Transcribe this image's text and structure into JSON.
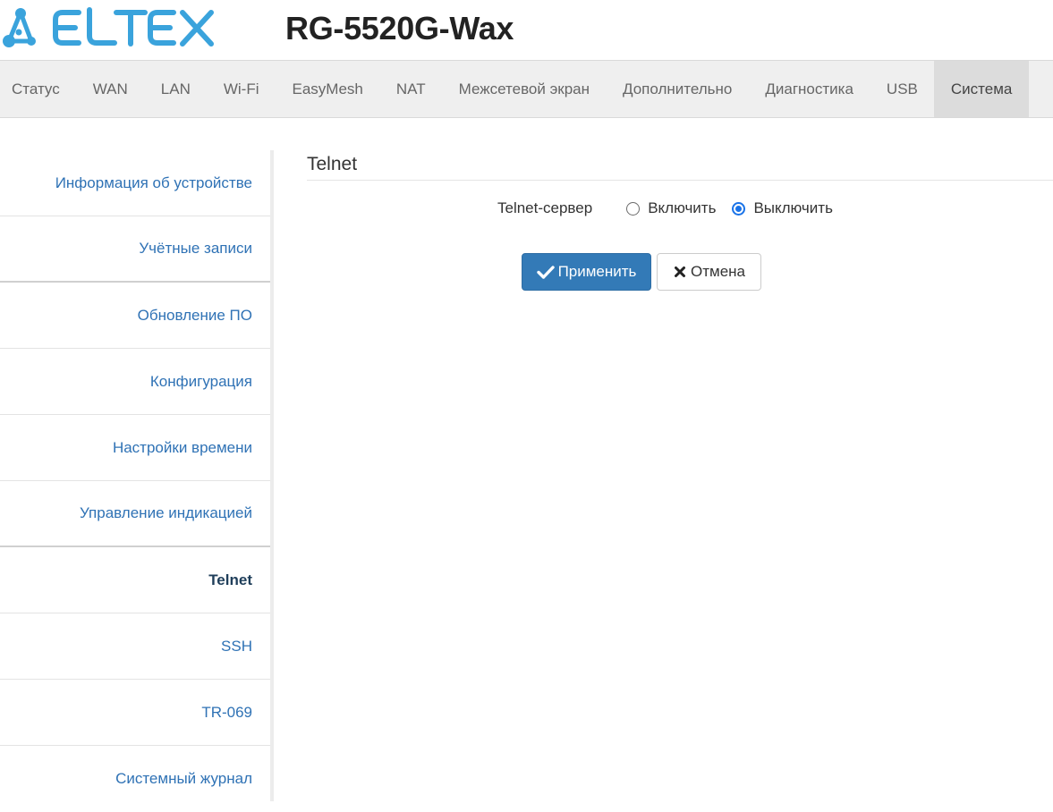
{
  "header": {
    "brand": "ELTEX",
    "model": "RG-5520G-Wax"
  },
  "topnav": {
    "tabs": [
      {
        "label": "Статус"
      },
      {
        "label": "WAN"
      },
      {
        "label": "LAN"
      },
      {
        "label": "Wi-Fi"
      },
      {
        "label": "EasyMesh"
      },
      {
        "label": "NAT"
      },
      {
        "label": "Межсетевой экран"
      },
      {
        "label": "Дополнительно"
      },
      {
        "label": "Диагностика"
      },
      {
        "label": "USB"
      },
      {
        "label": "Система"
      }
    ],
    "active": "Система"
  },
  "sidebar": {
    "items": [
      {
        "label": "Информация об устройстве"
      },
      {
        "label": "Учётные записи"
      },
      {
        "label": "Обновление ПО"
      },
      {
        "label": "Конфигурация"
      },
      {
        "label": "Настройки времени"
      },
      {
        "label": "Управление индикацией"
      },
      {
        "label": "Telnet"
      },
      {
        "label": "SSH"
      },
      {
        "label": "TR-069"
      },
      {
        "label": "Системный журнал"
      }
    ],
    "active": "Telnet"
  },
  "main": {
    "title": "Telnet",
    "telnet_server": {
      "label": "Telnet-сервер",
      "options": [
        {
          "label": "Включить",
          "checked": false
        },
        {
          "label": "Выключить",
          "checked": true
        }
      ]
    },
    "apply_label": "Применить",
    "cancel_label": "Отмена"
  },
  "colors": {
    "logo_blue": "#3aa3dc",
    "link_blue": "#2f72b5",
    "primary_button": "#337ab7",
    "radio_checked": "#1a73e8"
  },
  "icons": {
    "apply": "checkmark-icon",
    "cancel": "close-icon"
  }
}
